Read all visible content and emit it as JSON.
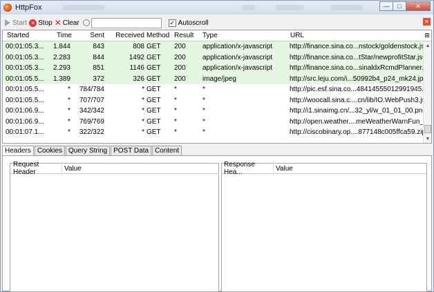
{
  "window": {
    "title": "HttpFox",
    "controls": {
      "minimize": "—",
      "maximize": "□",
      "close": "✕"
    }
  },
  "toolbar": {
    "start_label": "Start",
    "stop_label": "Stop",
    "clear_label": "Clear",
    "filter_value": "",
    "autoscroll_label": "Autoscroll",
    "autoscroll_checked": "✓"
  },
  "grid": {
    "headers": {
      "started": "Started",
      "time": "Time",
      "sent": "Sent",
      "received": "Received",
      "method": "Method",
      "result": "Result",
      "type": "Type",
      "url": "URL",
      "column_picker": "⊞"
    },
    "rows": [
      {
        "started": "00:01:05.3...",
        "time": "1.844",
        "sent": "843",
        "received": "808",
        "method": "GET",
        "result": "200",
        "type": "application/x-javascript",
        "url": "http://finance.sina.co...nstock/goldenstock.js",
        "loaded": true
      },
      {
        "started": "00:01:05.3...",
        "time": "2.283",
        "sent": "844",
        "received": "1492",
        "method": "GET",
        "result": "200",
        "type": "application/x-javascript",
        "url": "http://finance.sina.co...tStar/newprofitStar.js",
        "loaded": true
      },
      {
        "started": "00:01:05.3...",
        "time": "2.293",
        "sent": "851",
        "received": "1146",
        "method": "GET",
        "result": "200",
        "type": "application/x-javascript",
        "url": "http://finance.sina.co...sinaldxRcmdPlanner.js",
        "loaded": true
      },
      {
        "started": "00:01:05.5...",
        "time": "1.389",
        "sent": "372",
        "received": "326",
        "method": "GET",
        "result": "200",
        "type": "image/jpeg",
        "url": "http://src.leju.com/i...50992b4_p24_mk24.jpg",
        "loaded": true
      },
      {
        "started": "00:01:05.5...",
        "time": "*",
        "sent": "784/784",
        "received": "*",
        "method": "GET",
        "result": "*",
        "type": "*",
        "url": "http://pic.esf.sina.co...48414555012991945.jpg",
        "loaded": false
      },
      {
        "started": "00:01:05.5...",
        "time": "*",
        "sent": "707/707",
        "received": "*",
        "method": "GET",
        "result": "*",
        "type": "*",
        "url": "http://woocall.sina.c....cn/lib/IO.WebPush3.js",
        "loaded": false
      },
      {
        "started": "00:01:06.9...",
        "time": "*",
        "sent": "342/342",
        "received": "*",
        "method": "GET",
        "result": "*",
        "type": "*",
        "url": "http://i1.sinaimg.cn/...32_yl/w_01_01_00.png",
        "loaded": false
      },
      {
        "started": "00:01:06.9...",
        "time": "*",
        "sent": "769/769",
        "received": "*",
        "method": "GET",
        "result": "*",
        "type": "*",
        "url": "http://open.weather....meWeatherWarnFun_",
        "loaded": false
      },
      {
        "started": "00:01:07.1...",
        "time": "*",
        "sent": "322/322",
        "received": "*",
        "method": "GET",
        "result": "*",
        "type": "*",
        "url": "http://ciscobinary.op....877148c005ffca59.zip",
        "loaded": false
      }
    ]
  },
  "tabs": [
    "Headers",
    "Cookies",
    "Query String",
    "POST Data",
    "Content"
  ],
  "detail": {
    "request_header_label": "Request Header",
    "request_value_label": "Value",
    "response_header_label": "Response Hea...",
    "response_value_label": "Value"
  },
  "colors": {
    "loaded_row": "#e5f7e2",
    "titlebar": "#d3deee",
    "close_button": "#c7503f"
  }
}
